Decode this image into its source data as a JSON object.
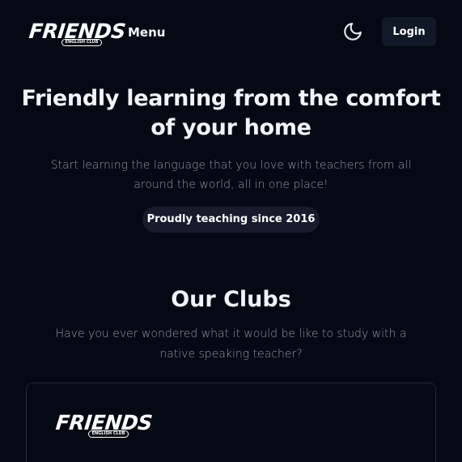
{
  "navbar": {
    "logo": {
      "word": "FRIENDS",
      "sub": "ENGLISH CLUB"
    },
    "menu_label": "Menu",
    "theme_icon": "moon-icon",
    "login_label": "Login"
  },
  "hero": {
    "title": "Friendly learning from the comfort of your home",
    "subtitle": "Start learning the language that you love with teachers from all around the world, all in one place!",
    "badge": "Proudly teaching since 2016"
  },
  "clubs": {
    "title": "Our Clubs",
    "subtitle": "Have you ever wondered what it would be like to study with a native speaking teacher?",
    "cards": [
      {
        "logo": {
          "word": "FRIENDS",
          "sub": "ENGLISH CLUB"
        }
      }
    ]
  },
  "colors": {
    "background": "#050914",
    "surface": "#111827",
    "badge_bg": "#161c2c",
    "text": "#f1f5f9",
    "muted": "#8b97a8",
    "border": "#1f2937"
  }
}
